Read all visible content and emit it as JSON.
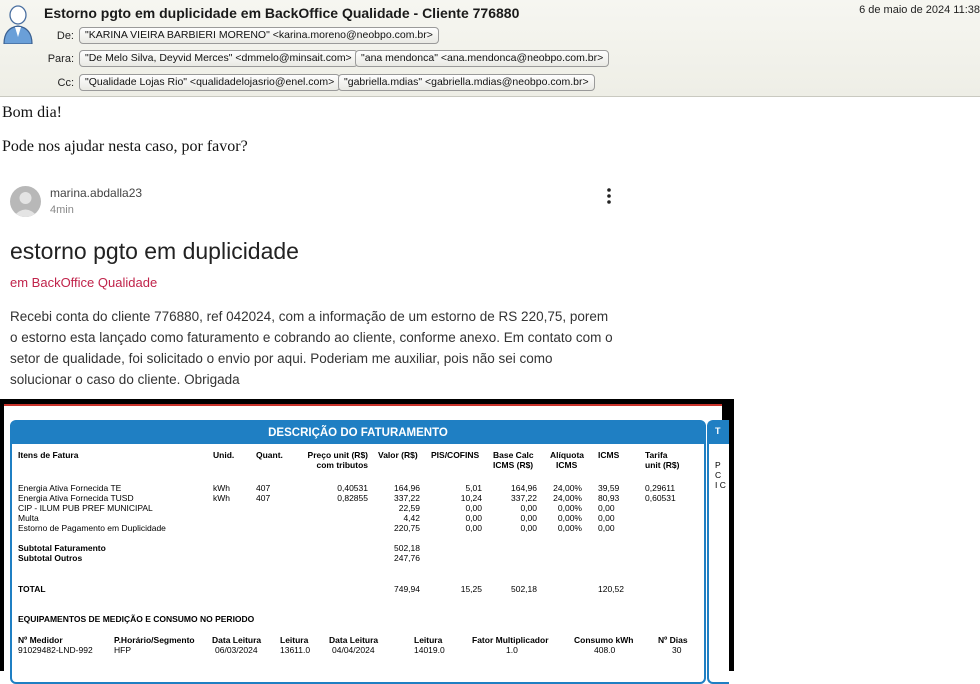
{
  "email": {
    "subject": "Estorno pgto em duplicidade em BackOffice Qualidade - Cliente 776880",
    "date": "6 de maio de 2024 11:38",
    "from_label": "De:",
    "to_label": "Para:",
    "cc_label": "Cc:",
    "from": [
      "\"KARINA VIEIRA BARBIERI MORENO\" <karina.moreno@neobpo.com.br>"
    ],
    "to": [
      "\"De Melo Silva, Deyvid Merces\" <dmmelo@minsait.com>",
      "\"ana mendonca\" <ana.mendonca@neobpo.com.br>"
    ],
    "cc": [
      "\"Qualidade Lojas Rio\" <qualidadelojasrio@enel.com>",
      "\"gabriella.mdias\" <gabriella.mdias@neobpo.com.br>"
    ],
    "greeting": "Bom dia!",
    "request": "Pode nos ajudar nesta caso, por favor?"
  },
  "post": {
    "author": "marina.abdalla23",
    "time": "4min",
    "title": "estorno pgto em duplicidade",
    "category": "em BackOffice Qualidade",
    "text": "Recebi conta do cliente 776880, ref 042024, com a informação de um estorno de RS 220,75, porem o estorno esta lançado como faturamento e cobrando ao cliente, conforme anexo. Em contato com o setor de qualidade, foi solicitado o envio por aqui. Poderiam me auxiliar, pois não sei como solucionar o caso do cliente. Obrigada"
  },
  "invoice": {
    "title": "DESCRIÇÃO DO FATURAMENTO",
    "headers": {
      "item": "Itens de Fatura",
      "unid": "Unid.",
      "quant": "Quant.",
      "preco1": "Preço unit (R$)",
      "preco2": "com tributos",
      "valor": "Valor (R$)",
      "pis": "PIS/COFINS",
      "base1": "Base Calc",
      "base2": "ICMS (R$)",
      "aliq1": "Alíquota",
      "aliq2": "ICMS",
      "icms": "ICMS",
      "tarifa1": "Tarifa",
      "tarifa2": "unit (R$)"
    },
    "rows": [
      [
        "Energia Ativa Fornecida TE",
        "kWh",
        "407",
        "0,40531",
        "164,96",
        "5,01",
        "164,96",
        "24,00%",
        "39,59",
        "0,29611"
      ],
      [
        "Energia Ativa Fornecida TUSD",
        "kWh",
        "407",
        "0,82855",
        "337,22",
        "10,24",
        "337,22",
        "24,00%",
        "80,93",
        "0,60531"
      ],
      [
        "CIP - ILUM PUB PREF MUNICIPAL",
        "",
        "",
        "",
        "22,59",
        "0,00",
        "0,00",
        "0,00%",
        "0,00",
        ""
      ],
      [
        "Multa",
        "",
        "",
        "",
        "4,42",
        "0,00",
        "0,00",
        "0,00%",
        "0,00",
        ""
      ],
      [
        "Estorno de Pagamento em Duplicidade",
        "",
        "",
        "",
        "220,75",
        "0,00",
        "0,00",
        "0,00%",
        "0,00",
        ""
      ]
    ],
    "subtotal_fat_label": "Subtotal Faturamento",
    "subtotal_fat_value": "502,18",
    "subtotal_out_label": "Subtotal Outros",
    "subtotal_out_value": "247,76",
    "total_label": "TOTAL",
    "total_valor": "749,94",
    "total_pis": "15,25",
    "total_base": "502,18",
    "total_icms": "120,52",
    "equip_title": "EQUIPAMENTOS DE MEDIÇÃO E CONSUMO NO PERIODO",
    "equip_headers": [
      "Nº Medidor",
      "P.Horário/Segmento",
      "Data Leitura",
      "Leitura",
      "Data Leitura",
      "Leitura",
      "Fator Multiplicador",
      "Consumo kWh",
      "Nº Dias"
    ],
    "equip_row": [
      "91029482-LND-992",
      "HFP",
      "06/03/2024",
      "13611.0",
      "04/04/2024",
      "14019.0",
      "1.0",
      "408.0",
      "30"
    ],
    "side_title": "T",
    "side_lines": [
      "P",
      "C",
      "I C"
    ]
  }
}
